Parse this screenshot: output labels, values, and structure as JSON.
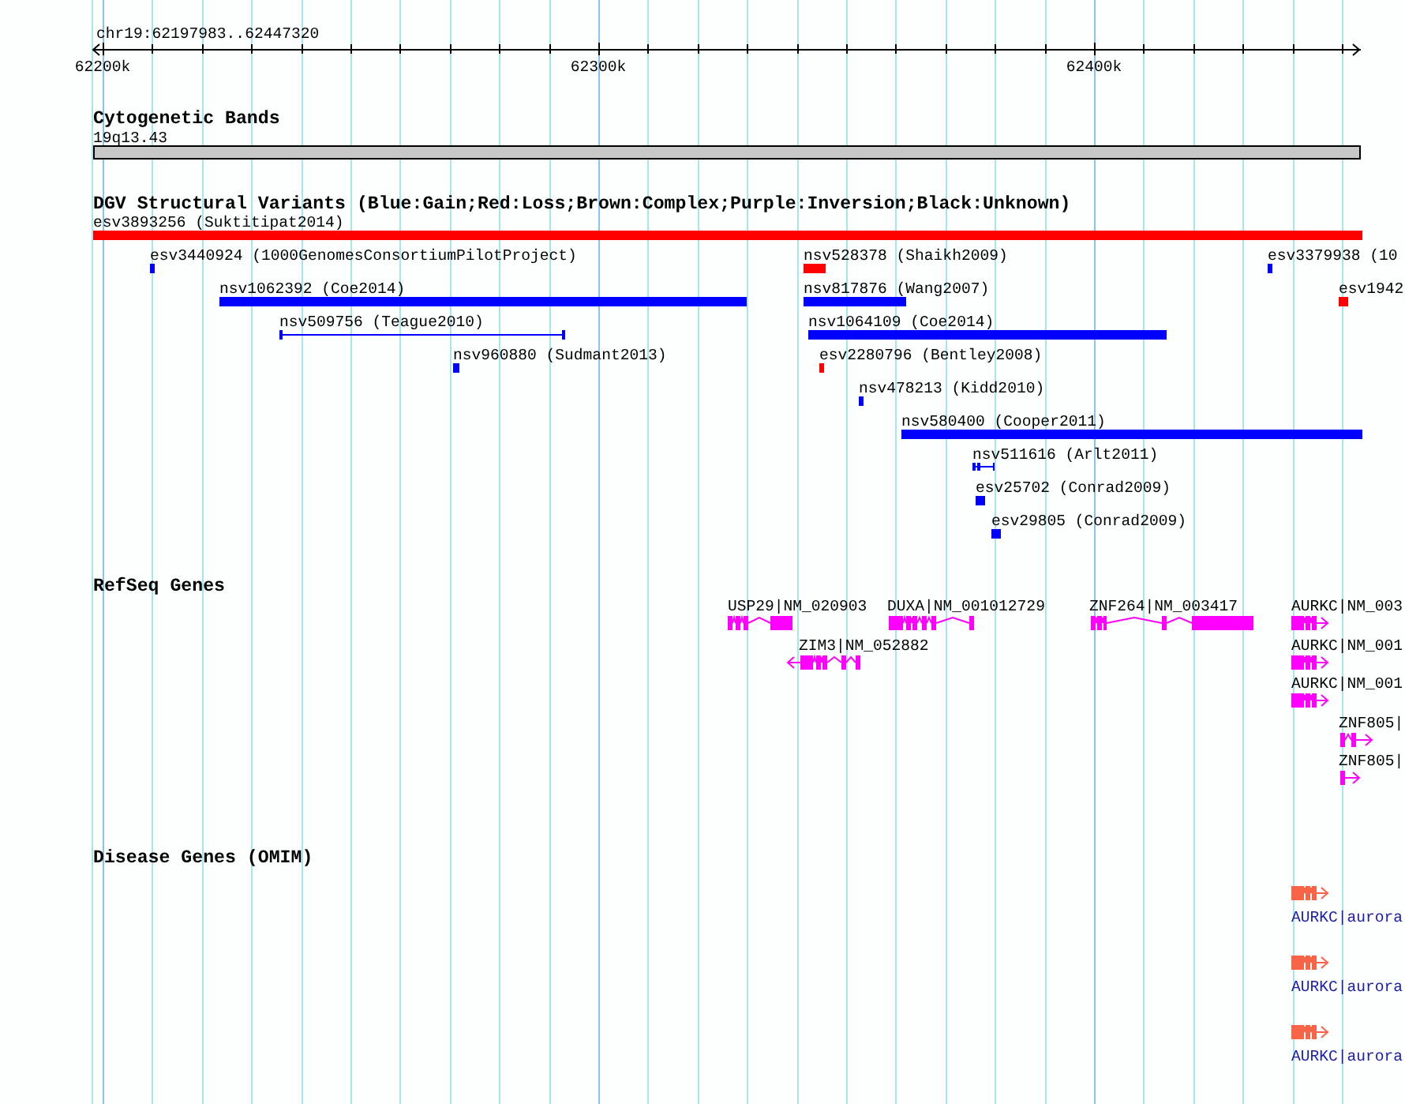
{
  "ruler": {
    "title": "chr19:62197983..62447320",
    "ticks": [
      "62200k",
      "62300k",
      "62400k"
    ]
  },
  "tracks": [
    {
      "title": "Cytogenetic Bands",
      "kind": "bands",
      "features": [
        {
          "label": "19q13.43"
        }
      ]
    },
    {
      "title": "DGV Structural Variants (Blue:Gain;Red:Loss;Brown:Complex;Purple:Inversion;Black:Unknown)",
      "kind": "variants",
      "features": [
        {
          "label": "esv3893256 (Suktitipat2014)",
          "color": "#ff0000"
        },
        {
          "label": "esv3440924 (1000GenomesConsortiumPilotProject)",
          "color": "#0000ff"
        },
        {
          "label": "nsv528378 (Shaikh2009)",
          "color": "#ff0000"
        },
        {
          "label": "esv3379938 (10",
          "color": "#0000ff"
        },
        {
          "label": "nsv1062392 (Coe2014)",
          "color": "#0000ff"
        },
        {
          "label": "nsv817876 (Wang2007)",
          "color": "#0000ff"
        },
        {
          "label": "esv1942",
          "color": "#ff0000"
        },
        {
          "label": "nsv509756 (Teague2010)",
          "color": "#0000ff"
        },
        {
          "label": "nsv1064109 (Coe2014)",
          "color": "#0000ff"
        },
        {
          "label": "nsv960880 (Sudmant2013)",
          "color": "#0000ff"
        },
        {
          "label": "esv2280796 (Bentley2008)",
          "color": "#ff0000"
        },
        {
          "label": "nsv478213 (Kidd2010)",
          "color": "#0000ff"
        },
        {
          "label": "nsv580400 (Cooper2011)",
          "color": "#0000ff"
        },
        {
          "label": "nsv511616 (Arlt2011)",
          "color": "#0000ff"
        },
        {
          "label": "esv25702 (Conrad2009)",
          "color": "#0000ff"
        },
        {
          "label": "esv29805 (Conrad2009)",
          "color": "#0000ff"
        }
      ]
    },
    {
      "title": "RefSeq Genes",
      "kind": "genes",
      "features": [
        {
          "label": "USP29|NM_020903"
        },
        {
          "label": "DUXA|NM_001012729"
        },
        {
          "label": "ZNF264|NM_003417"
        },
        {
          "label": "AURKC|NM_003"
        },
        {
          "label": "ZIM3|NM_052882"
        },
        {
          "label": "AURKC|NM_001"
        },
        {
          "label": "AURKC|NM_001"
        },
        {
          "label": "ZNF805|"
        },
        {
          "label": "ZNF805|"
        }
      ]
    },
    {
      "title": "Disease Genes (OMIM)",
      "kind": "omim",
      "features": [
        {
          "label": "AURKC|aurora"
        },
        {
          "label": "AURKC|aurora"
        },
        {
          "label": "AURKC|aurora"
        }
      ]
    }
  ]
}
